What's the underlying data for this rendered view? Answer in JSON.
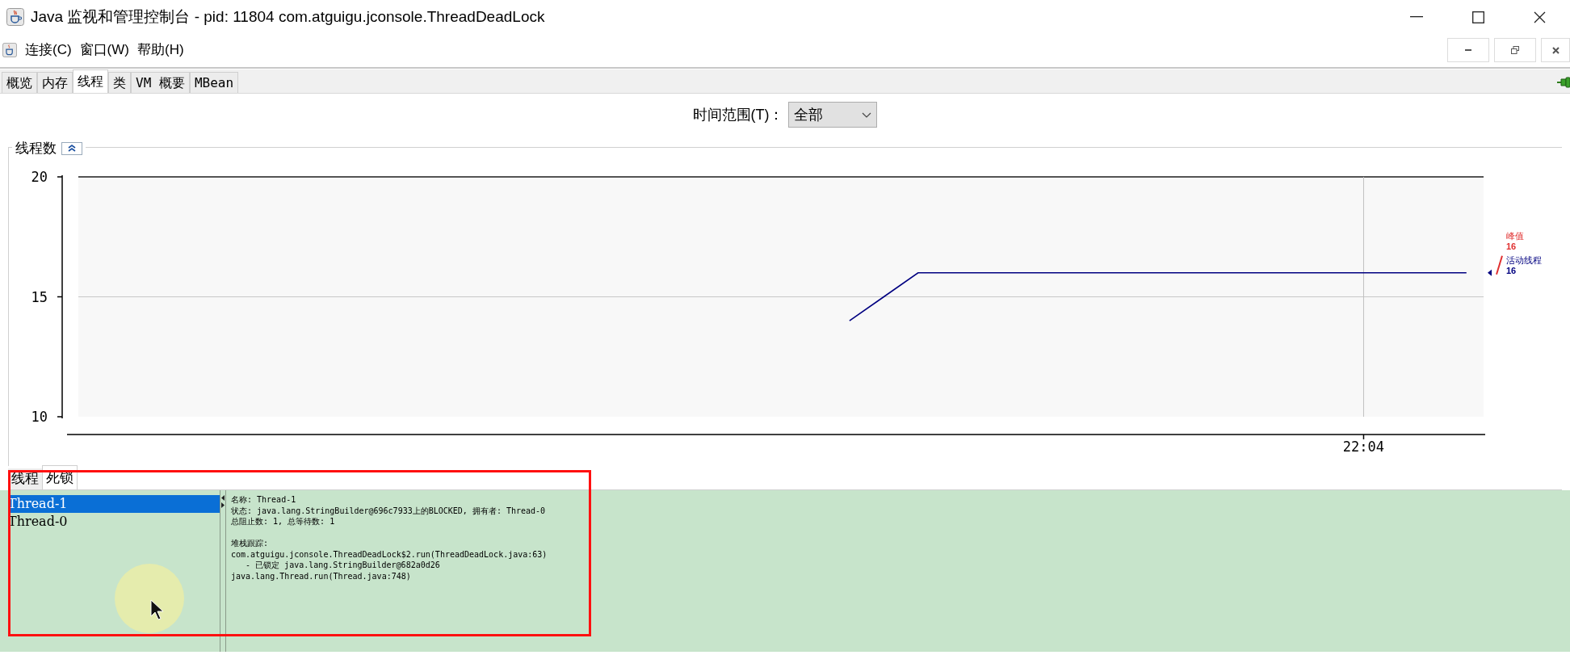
{
  "window": {
    "title": "Java 监视和管理控制台 - pid: 11804 com.atguigu.jconsole.ThreadDeadLock"
  },
  "menu": [
    "连接(C)",
    "窗口(W)",
    "帮助(H)"
  ],
  "tabs": [
    {
      "label": "概览",
      "selected": false
    },
    {
      "label": "内存",
      "selected": false
    },
    {
      "label": "线程",
      "selected": true
    },
    {
      "label": "类",
      "selected": false
    },
    {
      "label": "VM 概要",
      "selected": false
    },
    {
      "label": "MBean",
      "selected": false
    }
  ],
  "time_range": {
    "label": "时间范围(T)：",
    "value": "全部"
  },
  "thread_chart": {
    "title": "线程数",
    "peak": {
      "label": "峰值",
      "value": "16",
      "color": "#e03030"
    },
    "current_value": "16",
    "chart_data": {
      "type": "line",
      "categories": [
        null,
        null,
        null,
        null,
        null,
        null,
        null,
        null,
        null,
        null,
        null,
        null,
        null,
        null,
        null,
        null,
        null,
        null,
        null,
        null,
        null,
        null,
        null,
        null,
        null,
        null,
        null,
        null,
        null,
        null,
        null,
        null,
        null,
        null,
        null,
        null,
        null,
        "22:04",
        null,
        null,
        null
      ],
      "ylim": [
        10,
        20
      ],
      "yticks": [
        {
          "value": 10,
          "label": "10"
        },
        {
          "value": 15,
          "label": "15"
        },
        {
          "value": 20,
          "label": "20"
        }
      ],
      "ref_lines": [
        {
          "axis": "y",
          "value": 15
        }
      ],
      "series": [
        {
          "name": "活动线程",
          "color": "#000080",
          "values": [
            null,
            null,
            null,
            null,
            null,
            null,
            null,
            null,
            null,
            null,
            null,
            null,
            null,
            null,
            null,
            null,
            null,
            null,
            null,
            null,
            null,
            null,
            14,
            15,
            16,
            16,
            16,
            16,
            16,
            16,
            16,
            16,
            16,
            16,
            16,
            16,
            16,
            16,
            16,
            16,
            16
          ]
        }
      ]
    }
  },
  "detail_tabs": [
    {
      "label": "线程",
      "selected": false
    },
    {
      "label": "死锁",
      "selected": true
    }
  ],
  "threads": [
    {
      "name": "Thread-1",
      "selected": true
    },
    {
      "name": "Thread-0",
      "selected": false
    }
  ],
  "thread_detail": {
    "summary": [
      "名称: Thread-1",
      "状态: java.lang.StringBuilder@696c7933上的BLOCKED, 拥有者: Thread-0",
      "总阻止数: 1, 总等待数: 1"
    ],
    "stack_trace": [
      "堆栈跟踪:",
      "com.atguigu.jconsole.ThreadDeadLock$2.run(ThreadDeadLock.java:63)",
      "   - 已锁定 java.lang.StringBuilder@682a0d26",
      "java.lang.Thread.run(Thread.java:748)"
    ]
  }
}
